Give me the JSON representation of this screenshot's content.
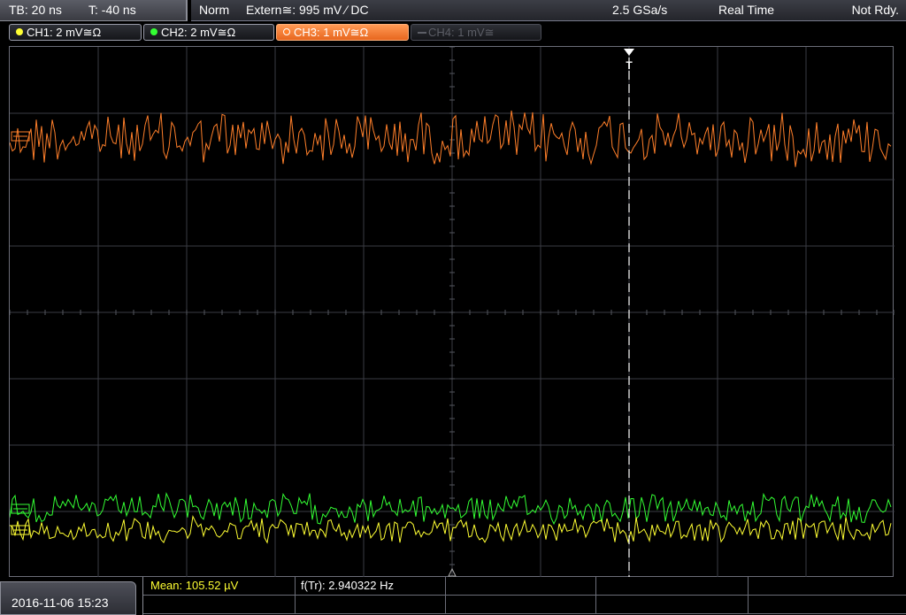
{
  "header": {
    "timebase": "TB: 20 ns",
    "time_offset": "T: -40 ns",
    "trigger_mode": "Norm",
    "trigger_source": "Extern≅: 995 mV ⁄ DC",
    "sample_rate": "2.5 GSa/s",
    "acquisition": "Real Time",
    "state": "Not Rdy."
  },
  "channels": [
    {
      "label": "CH1: 2 mV≅Ω",
      "color": "#ffff33",
      "active": true
    },
    {
      "label": "CH2: 2 mV≅Ω",
      "color": "#33ff33",
      "active": true
    },
    {
      "label": "CH3: 1 mV≅Ω",
      "color": "#ff7f2a",
      "active": true,
      "selected": true
    },
    {
      "label": "CH4: 1 mV≅",
      "color": "#5c5e66",
      "active": false
    }
  ],
  "trigger": {
    "marker_label": "T"
  },
  "colors": {
    "ch1": "#ffff33",
    "ch2": "#33ff33",
    "ch3": "#ff7f2a",
    "grid": "#3a3c44"
  },
  "footer": {
    "datetime": "2016-11-06 15:23",
    "measurement_1": "Mean: 105.52 µV",
    "measurement_2": "f(Tr): 2.940322 Hz"
  }
}
